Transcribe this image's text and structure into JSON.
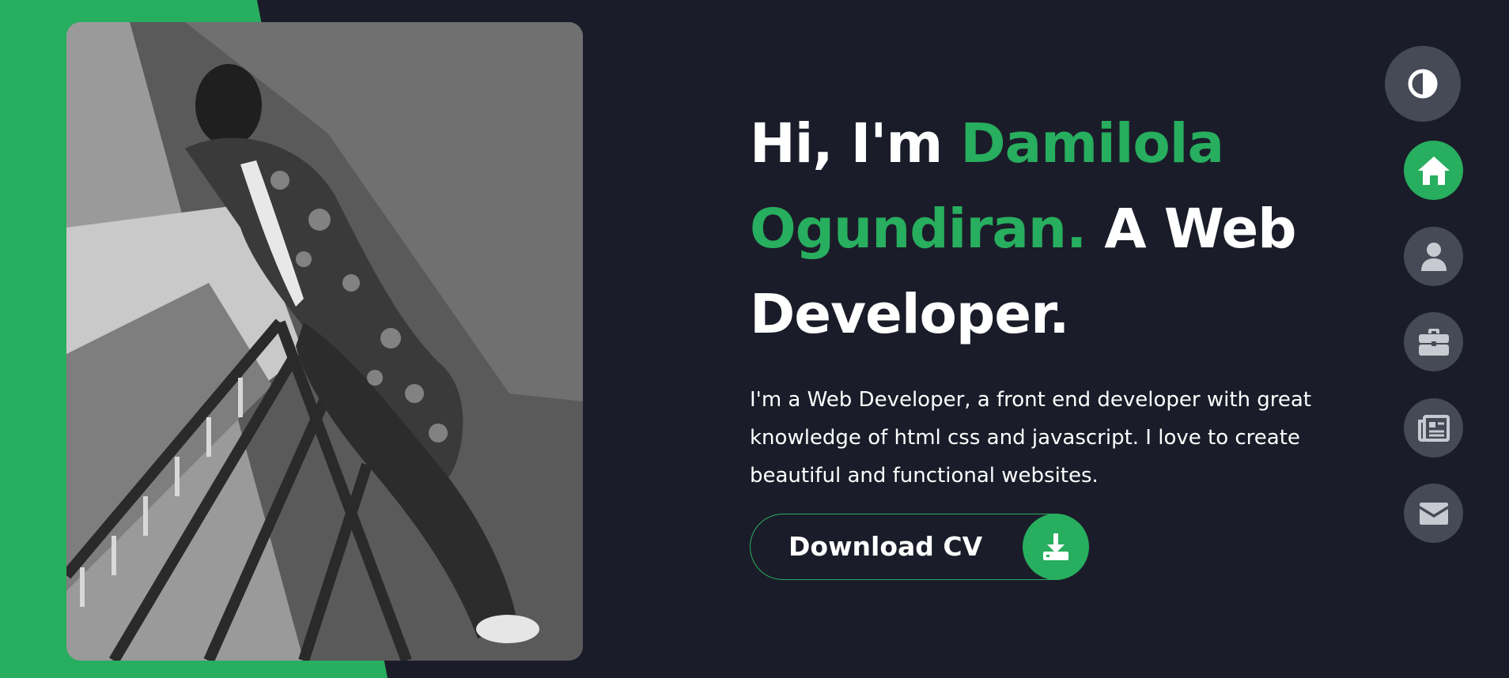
{
  "hero": {
    "greeting": "Hi, I'm ",
    "name": "Damilola Ogundiran.",
    "role": " A Web Developer.",
    "description": "I'm a Web Developer, a front end developer with great knowledge of html css and javascript. I love to create beautiful and functional websites."
  },
  "cta": {
    "download_label": "Download CV",
    "icon": "download-icon"
  },
  "nav": {
    "theme_icon": "contrast-icon",
    "items": [
      {
        "name": "home",
        "icon": "home-icon",
        "active": true
      },
      {
        "name": "about",
        "icon": "user-icon",
        "active": false
      },
      {
        "name": "portfolio",
        "icon": "briefcase-icon",
        "active": false
      },
      {
        "name": "blogs",
        "icon": "newspaper-icon",
        "active": false
      },
      {
        "name": "contact",
        "icon": "envelope-icon",
        "active": false
      }
    ]
  },
  "colors": {
    "accent": "#27ae5e",
    "background": "#1b1c29",
    "nav_button": "#454a56",
    "text": "#ffffff"
  }
}
